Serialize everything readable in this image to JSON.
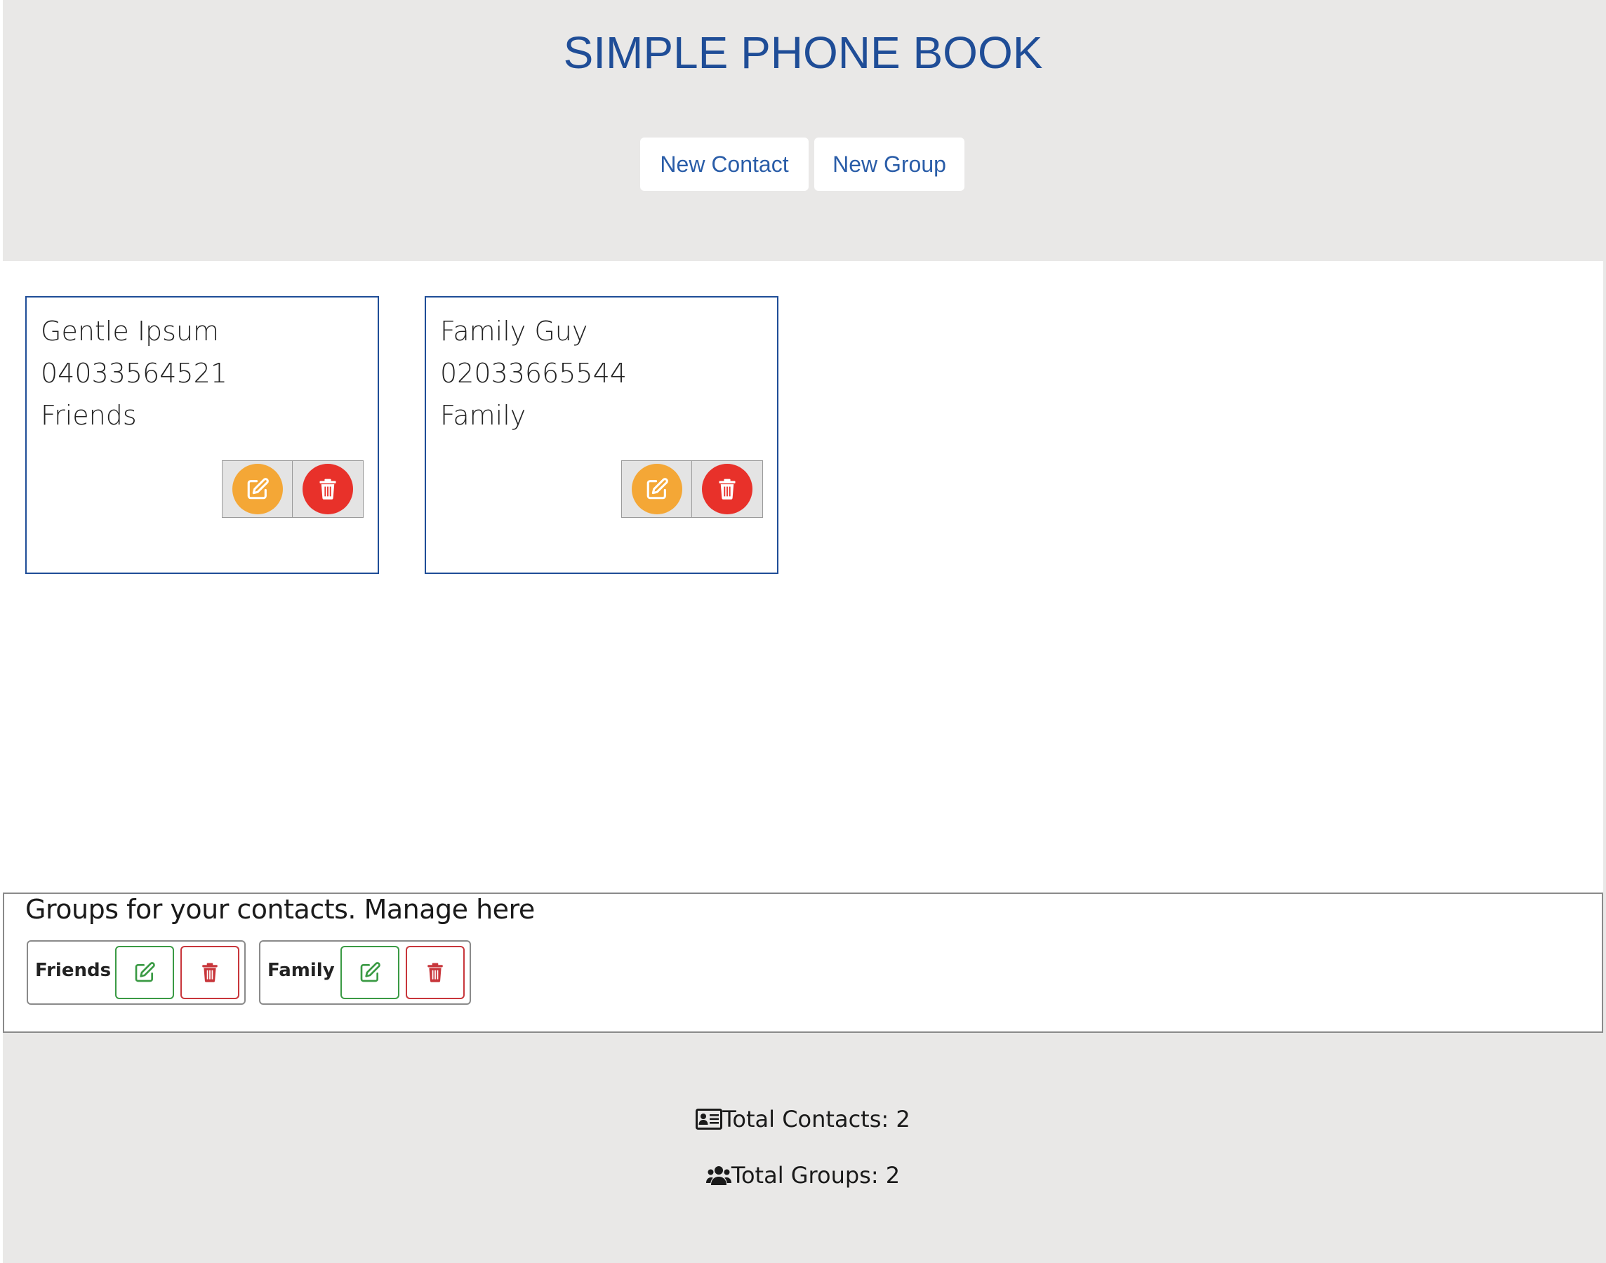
{
  "header": {
    "title": "SIMPLE PHONE BOOK",
    "new_contact_label": "New Contact",
    "new_group_label": "New Group"
  },
  "contacts": [
    {
      "name": "Gentle Ipsum",
      "phone": "04033564521",
      "group": "Friends"
    },
    {
      "name": "Family Guy",
      "phone": "02033665544",
      "group": "Family"
    }
  ],
  "groups_section": {
    "title": "Groups for your contacts. Manage here",
    "groups": [
      {
        "name": "Friends"
      },
      {
        "name": "Family"
      }
    ]
  },
  "footer": {
    "total_contacts": "Total Contacts: 2",
    "total_groups": "Total Groups: 2"
  },
  "icons": {
    "edit": "pencil-square-icon",
    "delete": "trash-icon",
    "contacts": "id-card-icon",
    "groups": "users-icon"
  },
  "colors": {
    "title": "#1f4d97",
    "edit_circle": "#f4a736",
    "delete_circle": "#e8312a",
    "edit_outline": "#3a9a44",
    "delete_outline": "#c8363b",
    "background": "#e9e8e7"
  }
}
